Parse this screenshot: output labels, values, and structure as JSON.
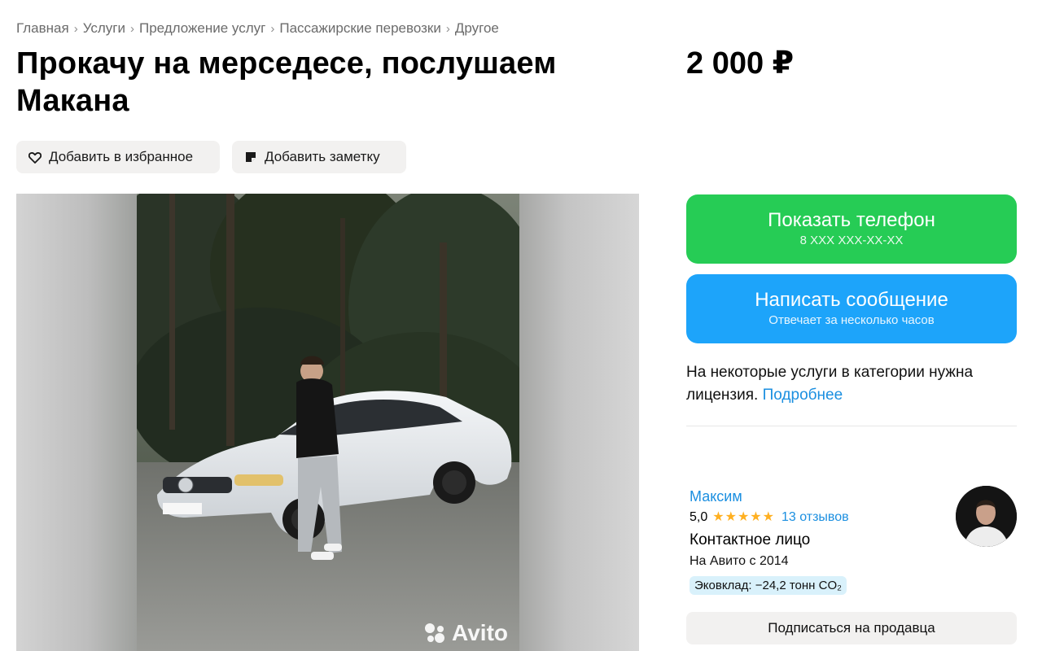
{
  "breadcrumbs": [
    "Главная",
    "Услуги",
    "Предложение услуг",
    "Пассажирские перевозки",
    "Другое"
  ],
  "listing": {
    "title": "Прокачу на мерседесе, послушаем Макана",
    "price": "2 000 ₽"
  },
  "actions": {
    "favorite_label": "Добавить в избранное",
    "note_label": "Добавить заметку"
  },
  "gallery": {
    "watermark": "Avito",
    "plate_text": ""
  },
  "contact": {
    "phone_label": "Показать телефон",
    "phone_masked": "8 XXX XXX-XX-XX",
    "message_label": "Написать сообщение",
    "message_sub": "Отвечает за несколько часов"
  },
  "notice": {
    "text": "На некоторые услуги в категории нужна лицензия.",
    "link": "Подробнее"
  },
  "seller": {
    "name": "Максим",
    "rating": "5,0",
    "stars": "★★★★★",
    "reviews": "13 отзывов",
    "role": "Контактное лицо",
    "since": "На Авито с 2014",
    "eco": "Эковклад: −24,2 тонн CO₂",
    "subscribe_label": "Подписаться на продавца"
  },
  "colors": {
    "green": "#26cc55",
    "blue": "#1da4fa",
    "link": "#1b8fe0",
    "star": "#ffb021"
  },
  "icons": [
    "heart-icon",
    "note-icon",
    "avito-logo-icon"
  ]
}
